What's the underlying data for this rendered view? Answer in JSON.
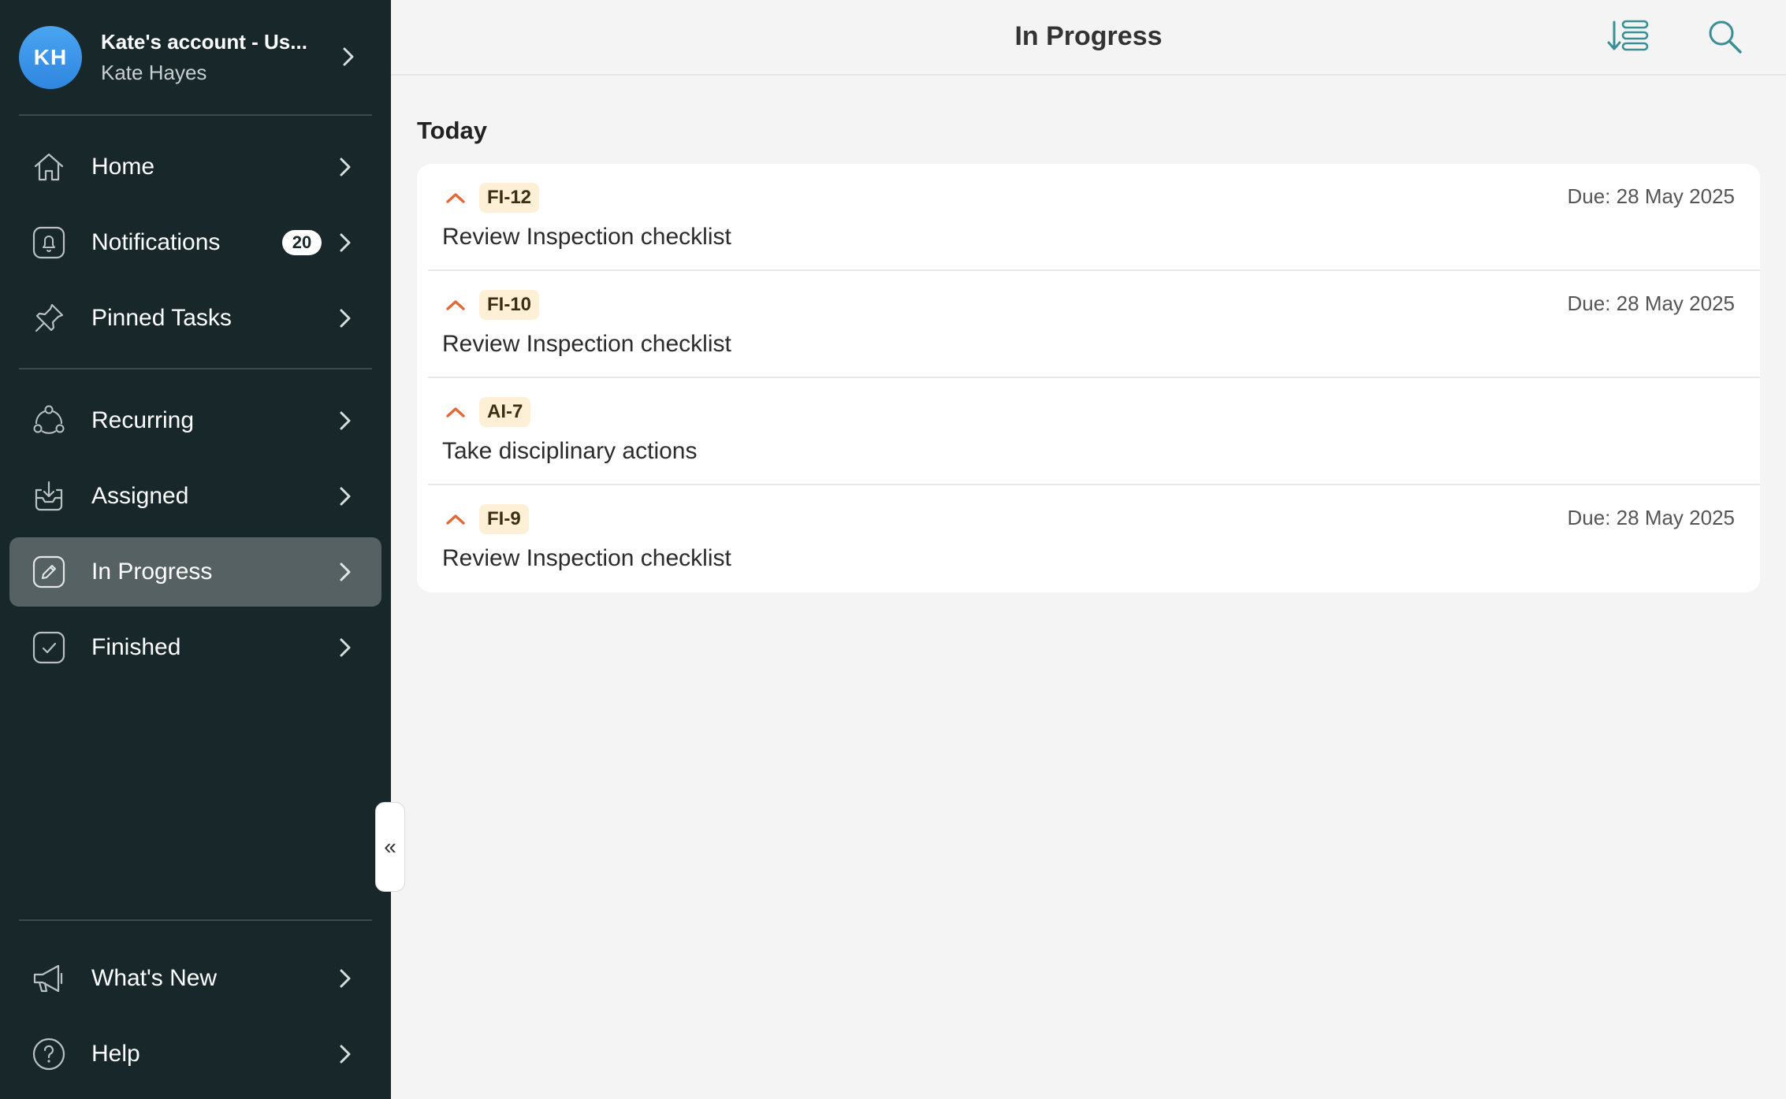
{
  "account": {
    "initials": "KH",
    "name": "Kate's account - Us...",
    "user": "Kate Hayes"
  },
  "nav": {
    "primary": [
      {
        "label": "Home",
        "icon": "home-icon"
      },
      {
        "label": "Notifications",
        "icon": "bell-icon",
        "badge": "20"
      },
      {
        "label": "Pinned Tasks",
        "icon": "pin-icon"
      }
    ],
    "tasks": [
      {
        "label": "Recurring",
        "icon": "recurring-icon"
      },
      {
        "label": "Assigned",
        "icon": "inbox-icon"
      },
      {
        "label": "In Progress",
        "icon": "edit-icon",
        "active": true
      },
      {
        "label": "Finished",
        "icon": "check-icon"
      }
    ],
    "footer": [
      {
        "label": "What's New",
        "icon": "megaphone-icon"
      },
      {
        "label": "Help",
        "icon": "help-icon"
      }
    ]
  },
  "collapse_glyph": "«",
  "header": {
    "title": "In Progress",
    "icons": [
      "sort-icon",
      "search-icon"
    ]
  },
  "section": {
    "title": "Today",
    "tasks": [
      {
        "id": "FI-12",
        "title": "Review Inspection checklist",
        "due": "Due: 28 May 2025"
      },
      {
        "id": "FI-10",
        "title": "Review Inspection checklist",
        "due": "Due: 28 May 2025"
      },
      {
        "id": "AI-7",
        "title": "Take disciplinary actions",
        "due": ""
      },
      {
        "id": "FI-9",
        "title": "Review Inspection checklist",
        "due": "Due: 28 May 2025"
      }
    ]
  },
  "colors": {
    "sidebar_bg": "#17272a",
    "active_item": "#566163",
    "accent_teal": "#3a8f96",
    "priority": "#e0693a",
    "tag_bg": "#fdf0d6"
  }
}
